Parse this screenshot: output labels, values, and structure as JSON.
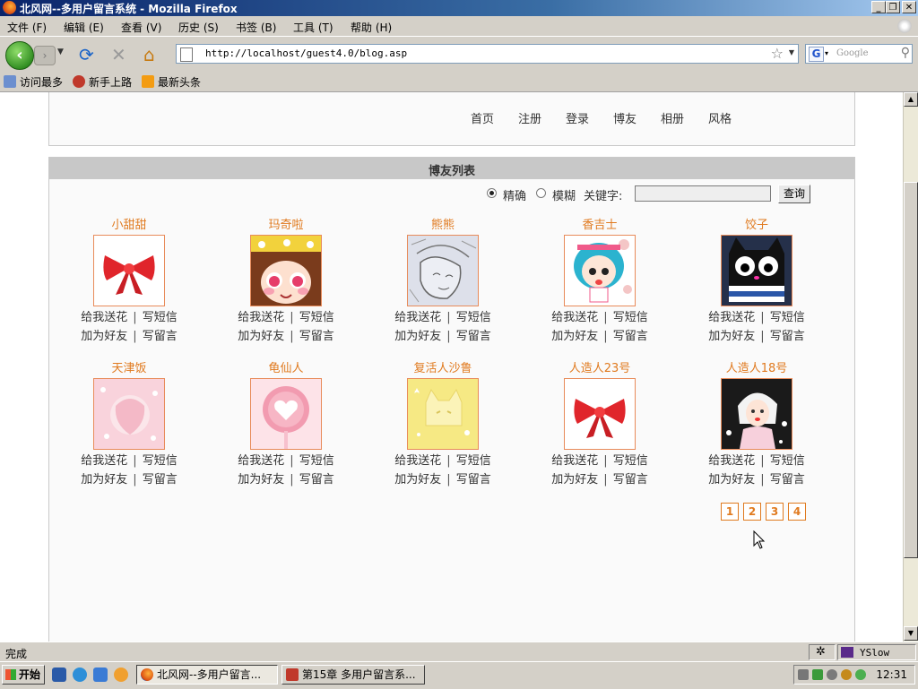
{
  "window": {
    "title": "北风网--多用户留言系统 - Mozilla Firefox"
  },
  "menu": [
    "文件 (F)",
    "编辑 (E)",
    "查看 (V)",
    "历史 (S)",
    "书签 (B)",
    "工具 (T)",
    "帮助 (H)"
  ],
  "nav": {
    "url": "http://localhost/guest4.0/blog.asp",
    "search_placeholder": "Google"
  },
  "bookmarks": [
    "访问最多",
    "新手上路",
    "最新头条"
  ],
  "site_nav": [
    "首页",
    "注册",
    "登录",
    "博友",
    "相册",
    "风格"
  ],
  "list": {
    "title": "博友列表",
    "search": {
      "exact_label": "精确",
      "fuzzy_label": "模糊",
      "keyword_label": "关键字:",
      "keyword_value": "",
      "button": "查询",
      "mode": "exact"
    },
    "actions": {
      "flower": "给我送花",
      "sms": "写短信",
      "friend": "加为好友",
      "message": "写留言",
      "separator": "|"
    },
    "users": [
      {
        "name": "小甜甜",
        "avatar": "red-bow-icon"
      },
      {
        "name": "玛奇啦",
        "avatar": "cartoon-girl-icon"
      },
      {
        "name": "熊熊",
        "avatar": "sketch-face-icon"
      },
      {
        "name": "香吉士",
        "avatar": "blue-hair-girl-icon"
      },
      {
        "name": "饺子",
        "avatar": "black-cat-icon"
      },
      {
        "name": "天津饭",
        "avatar": "pink-pattern-icon"
      },
      {
        "name": "龟仙人",
        "avatar": "heart-lollipop-icon"
      },
      {
        "name": "复活人沙鲁",
        "avatar": "yellow-cat-icon"
      },
      {
        "name": "人造人23号",
        "avatar": "red-bow-icon"
      },
      {
        "name": "人造人18号",
        "avatar": "fashion-girl-icon"
      }
    ],
    "pages": [
      "1",
      "2",
      "3",
      "4"
    ]
  },
  "status": {
    "text": "完成",
    "yslow": "YSlow"
  },
  "taskbar": {
    "start": "开始",
    "tasks": [
      "北风网--多用户留言...",
      "第15章 多用户留言系..."
    ],
    "clock": "12:31"
  }
}
